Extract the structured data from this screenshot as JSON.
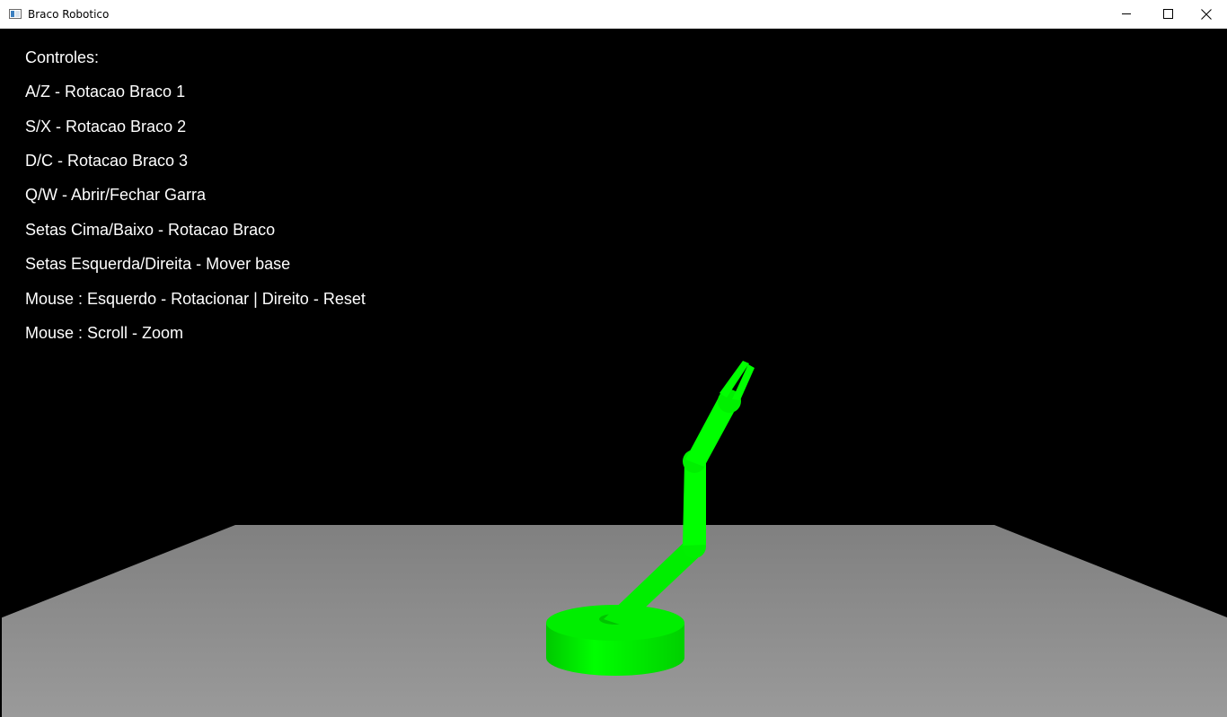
{
  "window": {
    "title": "Braco Robotico",
    "icons": {
      "app": "window-app-icon",
      "minimize": "minimize-icon",
      "maximize": "maximize-icon",
      "close": "close-icon"
    }
  },
  "controls": {
    "heading": "Controles:",
    "lines": [
      "A/Z - Rotacao Braco 1",
      "S/X - Rotacao Braco 2",
      "D/C - Rotacao Braco 3",
      "Q/W - Abrir/Fechar Garra",
      "Setas Cima/Baixo - Rotacao Braco",
      "Setas Esquerda/Direita - Mover base",
      "Mouse : Esquerdo - Rotacionar | Direito - Reset",
      "Mouse : Scroll - Zoom"
    ]
  },
  "scene": {
    "background_color": "#000000",
    "floor_color": "#8f8f8f",
    "robot_color": "#00ff00"
  }
}
